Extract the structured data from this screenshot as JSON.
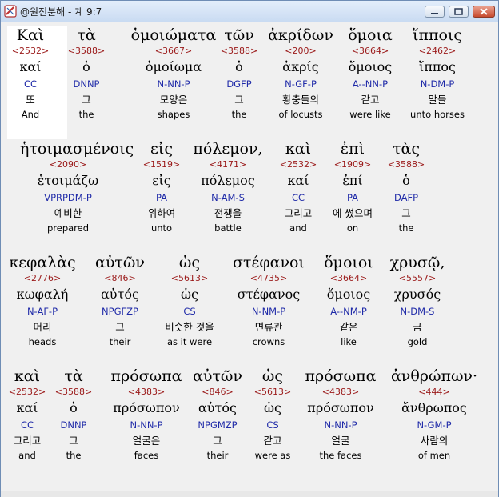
{
  "window": {
    "title": "@원전분해 - 계 9:7",
    "app_icon": "verse-analysis-icon",
    "controls": [
      "minimize-icon",
      "maximize-icon",
      "close-icon"
    ]
  },
  "colors": {
    "greek": "#000000",
    "strong": "#9b1a1a",
    "parsing": "#1f2aa8",
    "korean": "#000000",
    "english": "#000000",
    "selected_background": "#ffffff"
  },
  "selected_word_index": 0,
  "lines": [
    {
      "words": [
        {
          "greek": "Καὶ",
          "strong": "<2532>",
          "lemma": "καί",
          "parse": "CC",
          "korean": "또",
          "english": "And"
        },
        {
          "greek": "τὰ",
          "strong": "<3588>",
          "lemma": "ὁ",
          "parse": "DNNP",
          "korean": "그",
          "english": "the"
        },
        {
          "greek": "ὁμοιώματα",
          "strong": "<3667>",
          "lemma": "ὁμοίωμα",
          "parse": "N-NN-P",
          "korean": "모양은",
          "english": "shapes"
        },
        {
          "greek": "τῶν",
          "strong": "<3588>",
          "lemma": "ὁ",
          "parse": "DGFP",
          "korean": "그",
          "english": "the"
        },
        {
          "greek": "ἀκρίδων",
          "strong": "<200>",
          "lemma": "ἀκρίς",
          "parse": "N-GF-P",
          "korean": "황충들의",
          "english": "of locusts"
        },
        {
          "greek": "ὅμοια",
          "strong": "<3664>",
          "lemma": "ὅμοιος",
          "parse": "A--NN-P",
          "korean": "같고",
          "english": "were like"
        },
        {
          "greek": "ἵπποις",
          "strong": "<2462>",
          "lemma": "ἵππος",
          "parse": "N-DM-P",
          "korean": "말들",
          "english": "unto horses"
        }
      ]
    },
    {
      "words": [
        {
          "greek": "ἡτοιμασμένοις",
          "strong": "<2090>",
          "lemma": "ἑτοιμάζω",
          "parse": "VPRPDM-P",
          "korean": "예비한",
          "english": "prepared"
        },
        {
          "greek": "εἰς",
          "strong": "<1519>",
          "lemma": "εἰς",
          "parse": "PA",
          "korean": "위하여",
          "english": "unto"
        },
        {
          "greek": "πόλεμον,",
          "strong": "<4171>",
          "lemma": "πόλεμος",
          "parse": "N-AM-S",
          "korean": "전쟁을",
          "english": "battle"
        },
        {
          "greek": "καὶ",
          "strong": "<2532>",
          "lemma": "καί",
          "parse": "CC",
          "korean": "그리고",
          "english": "and"
        },
        {
          "greek": "ἐπὶ",
          "strong": "<1909>",
          "lemma": "ἐπί",
          "parse": "PA",
          "korean": "에 썼으며",
          "english": "on"
        },
        {
          "greek": "τὰς",
          "strong": "<3588>",
          "lemma": "ὁ",
          "parse": "DAFP",
          "korean": "그",
          "english": "the"
        }
      ]
    },
    {
      "words": [
        {
          "greek": "κεφαλὰς",
          "strong": "<2776>",
          "lemma": "κωφαλή",
          "parse": "N-AF-P",
          "korean": "머리",
          "english": "heads"
        },
        {
          "greek": "αὐτῶν",
          "strong": "<846>",
          "lemma": "αὐτός",
          "parse": "NPGFZP",
          "korean": "그",
          "english": "their"
        },
        {
          "greek": "ὡς",
          "strong": "<5613>",
          "lemma": "ὡς",
          "parse": "CS",
          "korean": "비슷한 것을",
          "english": "as it were"
        },
        {
          "greek": "στέφανοι",
          "strong": "<4735>",
          "lemma": "στέφανος",
          "parse": "N-NM-P",
          "korean": "면류관",
          "english": "crowns"
        },
        {
          "greek": "ὅμοιοι",
          "strong": "<3664>",
          "lemma": "ὅμοιος",
          "parse": "A--NM-P",
          "korean": "같은",
          "english": "like"
        },
        {
          "greek": "χρυσῷ,",
          "strong": "<5557>",
          "lemma": "χρυσός",
          "parse": "N-DM-S",
          "korean": "금",
          "english": "gold"
        }
      ]
    },
    {
      "words": [
        {
          "greek": "καὶ",
          "strong": "<2532>",
          "lemma": "καί",
          "parse": "CC",
          "korean": "그리고",
          "english": "and"
        },
        {
          "greek": "τὰ",
          "strong": "<3588>",
          "lemma": "ὁ",
          "parse": "DNNP",
          "korean": "그",
          "english": "the"
        },
        {
          "greek": "πρόσωπα",
          "strong": "<4383>",
          "lemma": "πρόσωπον",
          "parse": "N-NN-P",
          "korean": "얼굴은",
          "english": "faces"
        },
        {
          "greek": "αὐτῶν",
          "strong": "<846>",
          "lemma": "αὐτός",
          "parse": "NPGMZP",
          "korean": "그",
          "english": "their"
        },
        {
          "greek": "ὡς",
          "strong": "<5613>",
          "lemma": "ὡς",
          "parse": "CS",
          "korean": "같고",
          "english": "were as"
        },
        {
          "greek": "πρόσωπα",
          "strong": "<4383>",
          "lemma": "πρόσωπον",
          "parse": "N-NN-P",
          "korean": "얼굴",
          "english": "the faces"
        },
        {
          "greek": "ἀνθρώπων·",
          "strong": "<444>",
          "lemma": "ἄνθρωπος",
          "parse": "N-GM-P",
          "korean": "사람의",
          "english": "of men"
        }
      ]
    }
  ]
}
